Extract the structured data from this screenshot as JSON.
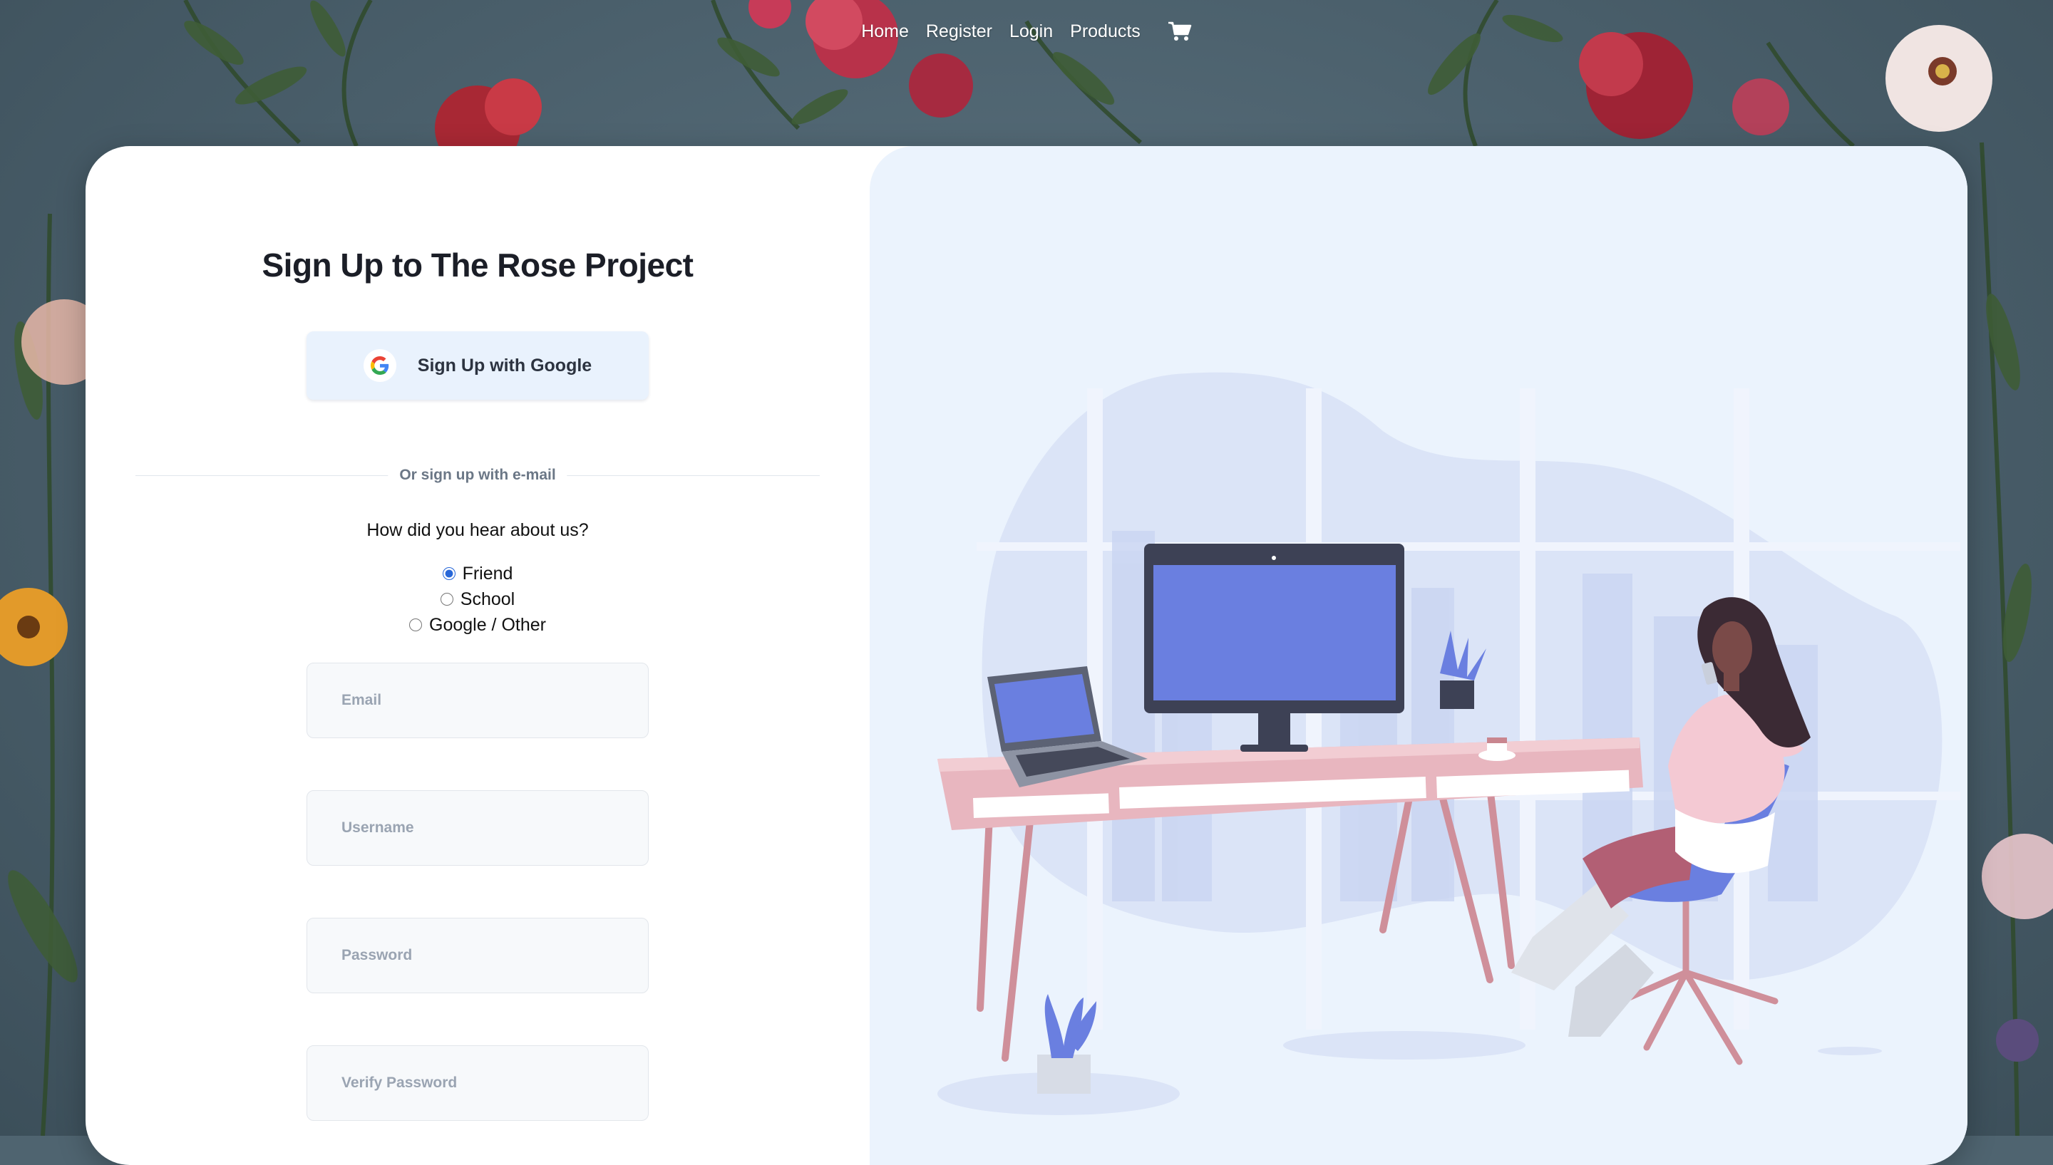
{
  "nav": {
    "items": [
      "Home",
      "Register",
      "Login",
      "Products"
    ],
    "cart_icon": "cart-icon"
  },
  "signup": {
    "title": "Sign Up to The Rose Project",
    "google_button": "Sign Up with Google",
    "google_icon": "google-icon",
    "divider": "Or sign up with e-mail",
    "question": "How did you hear about us?",
    "options": [
      {
        "label": "Friend",
        "checked": true
      },
      {
        "label": "School",
        "checked": false
      },
      {
        "label": "Google / Other",
        "checked": false
      }
    ],
    "fields": {
      "email_placeholder": "Email",
      "username_placeholder": "Username",
      "password_placeholder": "Password",
      "verify_placeholder": "Verify Password"
    }
  },
  "colors": {
    "accent": "#2867d8",
    "illustration_blue": "#6a7fe0",
    "desk_pink": "#e8b6bf",
    "panel_bg": "#ebf3fd"
  }
}
